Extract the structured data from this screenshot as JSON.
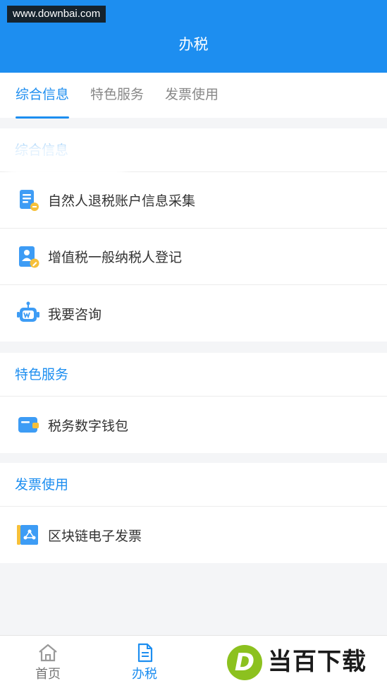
{
  "watermark": "www.downbai.com",
  "header": {
    "title": "办税"
  },
  "tabs": [
    {
      "label": "综合信息",
      "active": true
    },
    {
      "label": "特色服务",
      "active": false
    },
    {
      "label": "发票使用",
      "active": false
    }
  ],
  "sections": [
    {
      "title": "综合信息",
      "items": [
        {
          "label": "自然人退税账户信息采集",
          "icon": "document-coin-icon"
        },
        {
          "label": "增值税一般纳税人登记",
          "icon": "id-card-edit-icon"
        },
        {
          "label": "我要咨询",
          "icon": "robot-icon"
        }
      ]
    },
    {
      "title": "特色服务",
      "items": [
        {
          "label": "税务数字钱包",
          "icon": "wallet-icon"
        }
      ]
    },
    {
      "title": "发票使用",
      "items": [
        {
          "label": "区块链电子发票",
          "icon": "blockchain-invoice-icon"
        }
      ]
    }
  ],
  "tabbar": [
    {
      "label": "首页",
      "icon": "home-icon",
      "active": false
    },
    {
      "label": "办税",
      "icon": "document-icon",
      "active": true
    }
  ],
  "logo": {
    "mark": "D",
    "text": "当百下载"
  },
  "colors": {
    "primary": "#1d8ef0",
    "background": "#f4f5f7",
    "logo_green": "#8cc11f"
  }
}
